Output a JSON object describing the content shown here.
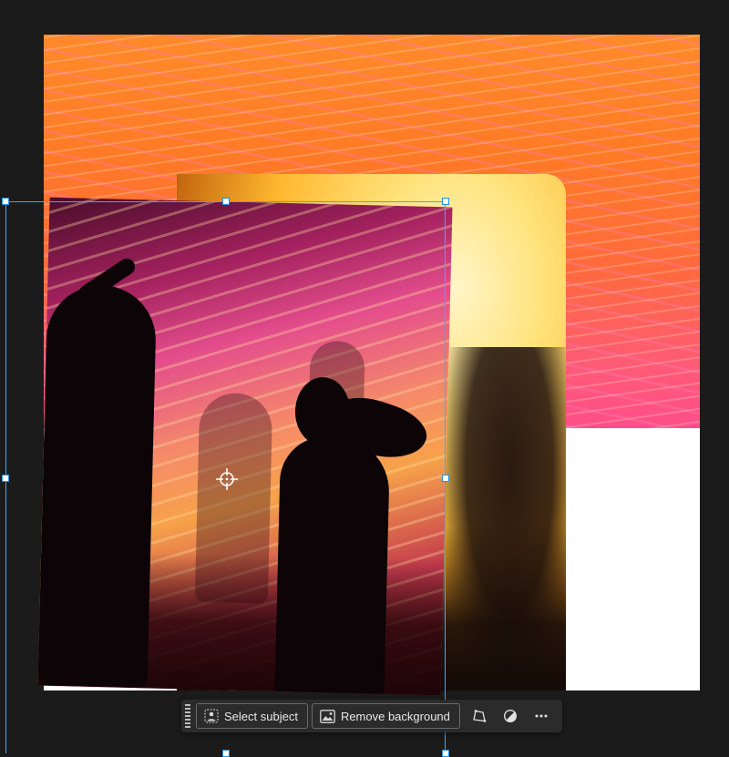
{
  "toolbar": {
    "select_subject_label": "Select subject",
    "remove_background_label": "Remove background",
    "icons": [
      "subject-icon",
      "image-icon",
      "perspective-icon",
      "adjust-icon",
      "more-icon"
    ]
  },
  "colors": {
    "canvas_bg": "#1b1b1b",
    "selection": "#3ea8ff",
    "toolbar_bg": "#2b2b2b"
  }
}
